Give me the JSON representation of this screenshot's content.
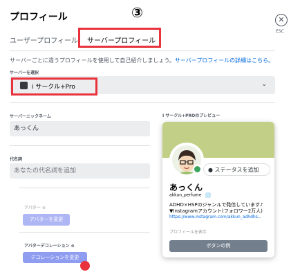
{
  "header": {
    "title": "プロフィール",
    "step_marker": "③",
    "esc_label": "ESC",
    "close_glyph": "✕"
  },
  "tabs": [
    {
      "label": "ユーザープロフィール",
      "selected": false
    },
    {
      "label": "サーバープロフィール",
      "selected": true
    }
  ],
  "description": {
    "text": "サーバーごとに違うプロフィールを使用して自己紹介しましょう。",
    "link": "サーバープロフィールの詳細はこちら。"
  },
  "server_select": {
    "label": "サーバーを選択",
    "value": "i サークル+Pro"
  },
  "form": {
    "nickname_label": "サーバーニックネーム",
    "nickname_value": "あっくん",
    "pronouns_label": "代名詞",
    "pronouns_placeholder": "あなたの代名詞を追加",
    "avatar_label": "アバター",
    "avatar_button": "アバターを変更",
    "decoration_label": "アバターデコレーション",
    "decoration_button": "デコレーションを変更"
  },
  "preview": {
    "label": "I サークル+PROのプレビュー",
    "status_button": "ステータスを追加",
    "display_name": "あっくん",
    "username": "akkun_perfume",
    "bio_line1": "ADHD×HSPのジャンルで発信しています♪",
    "bio_line2": "▼Instagramアカウント(フォロワー2万人)",
    "bio_link": "https://www.instagram.com/akkun_adhdhs...",
    "show_profile": "プロフィールを表示",
    "example_button": "ボタンの例"
  },
  "colors": {
    "highlight": "#e8323c",
    "link": "#0068e0",
    "banner": "#c2cf86",
    "online": "#3ba55d",
    "button_disabled": "#aeb6f4"
  }
}
